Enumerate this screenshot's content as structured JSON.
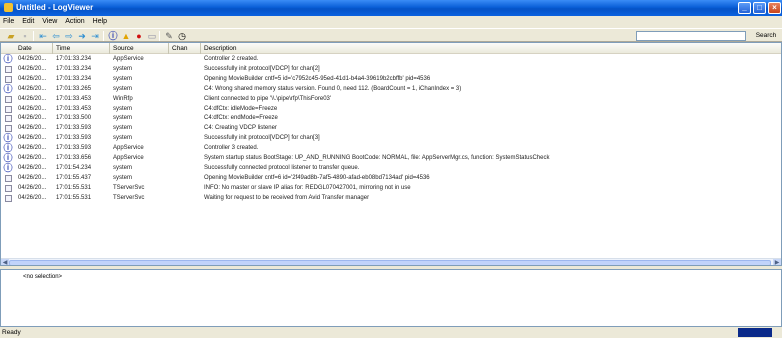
{
  "window": {
    "title": "Untitled - LogViewer"
  },
  "menu": [
    "File",
    "Edit",
    "View",
    "Action",
    "Help"
  ],
  "toolbar": {
    "icons": [
      "open-icon",
      "save-icon",
      "first-icon",
      "prev-icon",
      "next-icon",
      "forward-icon",
      "last-icon",
      "info-filter-icon",
      "warning-filter-icon",
      "error-filter-icon",
      "document-filter-icon",
      "pen-icon",
      "clock-icon"
    ],
    "search_placeholder": "",
    "search_label": "Search"
  },
  "columns": [
    "Date",
    "Time",
    "Source",
    "Chan",
    "Description"
  ],
  "rows": [
    {
      "icon": "info",
      "date": "04/26/20...",
      "time": "17:01:33.234",
      "source": "AppService",
      "chan": "",
      "desc": "Controller 2 created."
    },
    {
      "icon": "doc",
      "date": "04/26/20...",
      "time": "17:01:33.234",
      "source": "system",
      "chan": "",
      "desc": "Successfully init protocol[VDCP] for chan[2]"
    },
    {
      "icon": "doc",
      "date": "04/26/20...",
      "time": "17:01:33.234",
      "source": "system",
      "chan": "",
      "desc": "    Opening MovieBuilder cntf=5 id='c7952c45-95ed-41d1-b4a4-39619b2cbffb' pid=4536"
    },
    {
      "icon": "info",
      "date": "04/26/20...",
      "time": "17:01:33.265",
      "source": "system",
      "chan": "",
      "desc": "C4: Wrong shared memory status version. Found 0, need 112. (BoardCount = 1, iChanIndex = 3)"
    },
    {
      "icon": "doc",
      "date": "04/26/20...",
      "time": "17:01:33.453",
      "source": "WinRfp",
      "chan": "",
      "desc": "Client connected to pipe '\\\\.\\pipe\\rfp\\ThisFore03'"
    },
    {
      "icon": "doc",
      "date": "04/26/20...",
      "time": "17:01:33.453",
      "source": "system",
      "chan": "",
      "desc": "    C4:dfCtx: idleMode=Freeze"
    },
    {
      "icon": "doc",
      "date": "04/26/20...",
      "time": "17:01:33.500",
      "source": "system",
      "chan": "",
      "desc": "    C4:dfCtx: endMode=Freeze"
    },
    {
      "icon": "doc",
      "date": "04/26/20...",
      "time": "17:01:33.593",
      "source": "system",
      "chan": "",
      "desc": "C4: Creating VDCP listener"
    },
    {
      "icon": "info",
      "date": "04/26/20...",
      "time": "17:01:33.593",
      "source": "system",
      "chan": "",
      "desc": "Successfully init protocol[VDCP] for chan[3]"
    },
    {
      "icon": "info",
      "date": "04/26/20...",
      "time": "17:01:33.593",
      "source": "AppService",
      "chan": "",
      "desc": "Controller 3 created."
    },
    {
      "icon": "info",
      "date": "04/26/20...",
      "time": "17:01:33.656",
      "source": "AppService",
      "chan": "",
      "desc": "System startup status BootStage: UP_AND_RUNNING BootCode: NORMAL, file: AppServerMgr.cs, function: SystemStatusCheck"
    },
    {
      "icon": "info",
      "date": "04/26/20...",
      "time": "17:01:54.234",
      "source": "system",
      "chan": "",
      "desc": "Successfully connected protocol listener to transfer queue."
    },
    {
      "icon": "doc",
      "date": "04/26/20...",
      "time": "17:01:55.437",
      "source": "system",
      "chan": "",
      "desc": "    Opening MovieBuilder cntf=6 id='2f49ad8b-7af5-4890-afad-eb08bd7134ad' pid=4536"
    },
    {
      "icon": "doc",
      "date": "04/26/20...",
      "time": "17:01:55.531",
      "source": "TServerSvc",
      "chan": "",
      "desc": "INFO: No master or slave IP alias for: REDGL070427001, mirroring not in use"
    },
    {
      "icon": "doc",
      "date": "04/26/20...",
      "time": "17:01:55.531",
      "source": "TServerSvc",
      "chan": "",
      "desc": "Waiting for request to be received from Avid Transfer manager"
    }
  ],
  "detail": {
    "text": "<no selection>"
  },
  "status": {
    "text": "Ready"
  }
}
